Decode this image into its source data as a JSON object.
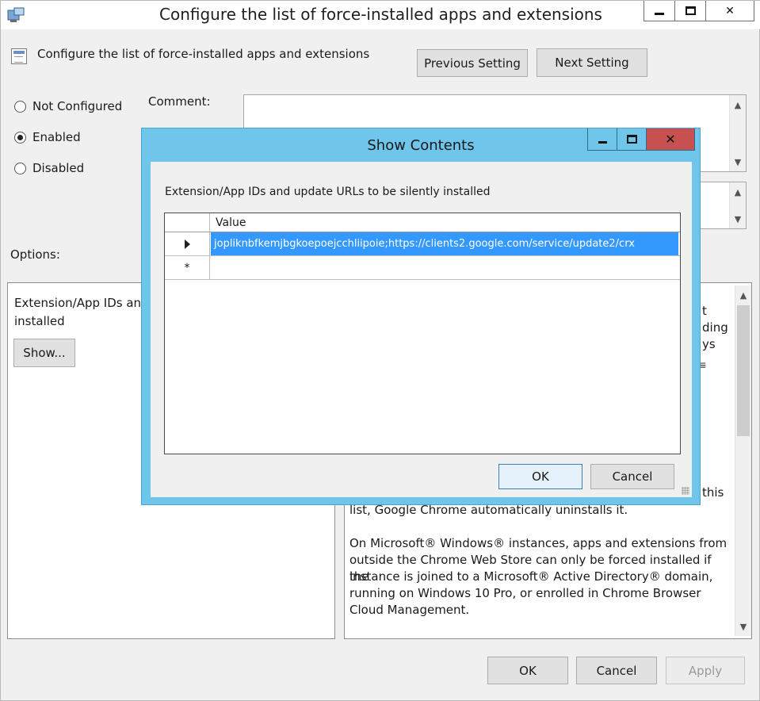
{
  "main_window": {
    "title": "Configure the list of force-installed apps and extensions",
    "setting_name": "Configure the list of force-installed apps and extensions",
    "previous_setting_label": "Previous Setting",
    "next_setting_label": "Next Setting",
    "state_options": [
      {
        "label": "Not Configured",
        "selected": false
      },
      {
        "label": "Enabled",
        "selected": true
      },
      {
        "label": "Disabled",
        "selected": false
      }
    ],
    "comment_label": "Comment:",
    "options_label": "Options:",
    "options_panel": {
      "field_label_line1": "Extension/App IDs and",
      "field_label_line2": "installed",
      "show_button": "Show..."
    },
    "help_panel": {
      "fragments": [
        "t",
        "ding",
        "ys",
        "this"
      ],
      "line_uninstall": "list, Google Chrome automatically uninstalls it.",
      "paragraph_lines": [
        "On Microsoft® Windows® instances, apps and extensions from",
        "outside the Chrome Web Store can only be forced installed if the",
        "instance is joined to a Microsoft® Active Directory® domain,",
        "running on Windows 10 Pro, or enrolled in Chrome Browser",
        "Cloud Management."
      ]
    },
    "ok_label": "OK",
    "cancel_label": "Cancel",
    "apply_label": "Apply"
  },
  "show_contents_dialog": {
    "title": "Show Contents",
    "description": "Extension/App IDs and update URLs to be silently installed",
    "column_header": "Value",
    "rows": [
      {
        "marker": "current-row",
        "value": "jopliknbfkemjbgkoepoejcchliipoie;https://clients2.google.com/service/update2/crx"
      },
      {
        "marker": "*",
        "value": ""
      }
    ],
    "ok_label": "OK",
    "cancel_label": "Cancel"
  }
}
